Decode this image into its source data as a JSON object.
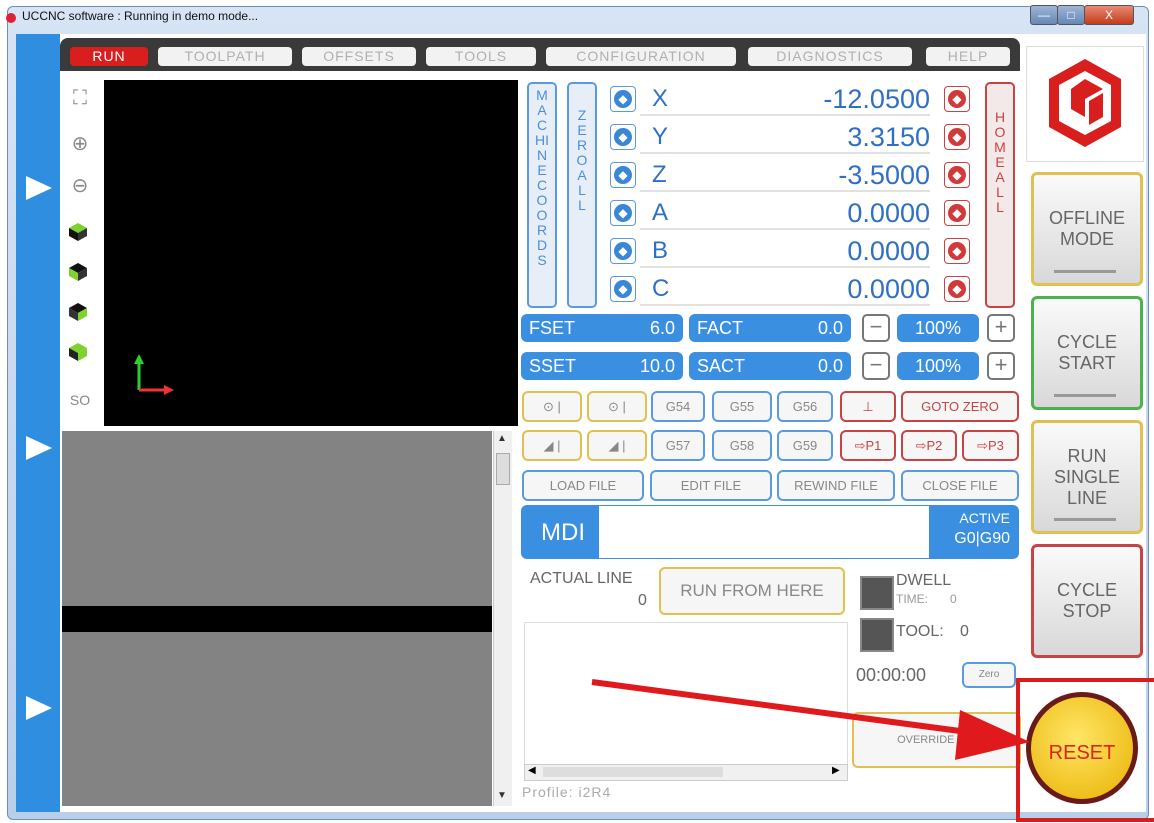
{
  "window": {
    "title": "UCCNC software : Running in demo mode...",
    "controls": [
      "—",
      "□",
      "X"
    ]
  },
  "tabs": [
    "RUN",
    "TOOLPATH",
    "OFFSETS",
    "TOOLS",
    "CONFIGURATION",
    "DIAGNOSTICS",
    "HELP"
  ],
  "view_tools": [
    "expand-icon",
    "zoom-in-icon",
    "zoom-out-icon",
    "cube-view-icon",
    "cube-view-icon",
    "cube-view-icon",
    "cube-view-icon"
  ],
  "iso_label": "SO",
  "dro": {
    "machine_coords_label": "MACHINE COORDS",
    "zero_all_label": "ZERO ALL",
    "home_all_label": "HOME ALL",
    "axes": [
      {
        "name": "X",
        "value": "-12.0500"
      },
      {
        "name": "Y",
        "value": "3.3150"
      },
      {
        "name": "Z",
        "value": "-3.5000"
      },
      {
        "name": "A",
        "value": "0.0000"
      },
      {
        "name": "B",
        "value": "0.0000"
      },
      {
        "name": "C",
        "value": "0.0000"
      }
    ]
  },
  "feed": {
    "set_label": "FSET",
    "set_value": "6.0",
    "act_label": "FACT",
    "act_value": "0.0",
    "override": "100%"
  },
  "spindle": {
    "set_label": "SSET",
    "set_value": "10.0",
    "act_label": "SACT",
    "act_value": "0.0",
    "override": "100%"
  },
  "work_offsets": [
    "G54",
    "G55",
    "G56",
    "G57",
    "G58",
    "G59"
  ],
  "goto_zero": "GOTO ZERO",
  "park": [
    "P1",
    "P2",
    "P3"
  ],
  "file_buttons": [
    "LOAD FILE",
    "EDIT FILE",
    "REWIND FILE",
    "CLOSE FILE"
  ],
  "mdi": {
    "label": "MDI",
    "active_label": "ACTIVE",
    "active_codes": "G0|G90"
  },
  "actual_line": {
    "label": "ACTUAL LINE",
    "value": "0"
  },
  "run_from_here": "RUN FROM HERE",
  "dwell": {
    "label": "DWELL",
    "time_label": "TIME:",
    "time_value": "0"
  },
  "tool": {
    "label": "TOOL:",
    "value": "0"
  },
  "timer": "00:00:00",
  "timer_zero": "Zero",
  "override_limits": "OVERRIDE LI...",
  "profile": "Profile: i2R4",
  "side_buttons": {
    "offline": [
      "OFFLINE",
      "MODE"
    ],
    "cycle_start": [
      "CYCLE",
      "START"
    ],
    "run_single_line": [
      "RUN",
      "SINGLE",
      "LINE"
    ],
    "cycle_stop": [
      "CYCLE",
      "STOP"
    ],
    "reset": "RESET"
  },
  "colors": {
    "accent": "#3a8fe0",
    "danger": "#d91e1e",
    "reset_yellow": "#f5c400"
  }
}
